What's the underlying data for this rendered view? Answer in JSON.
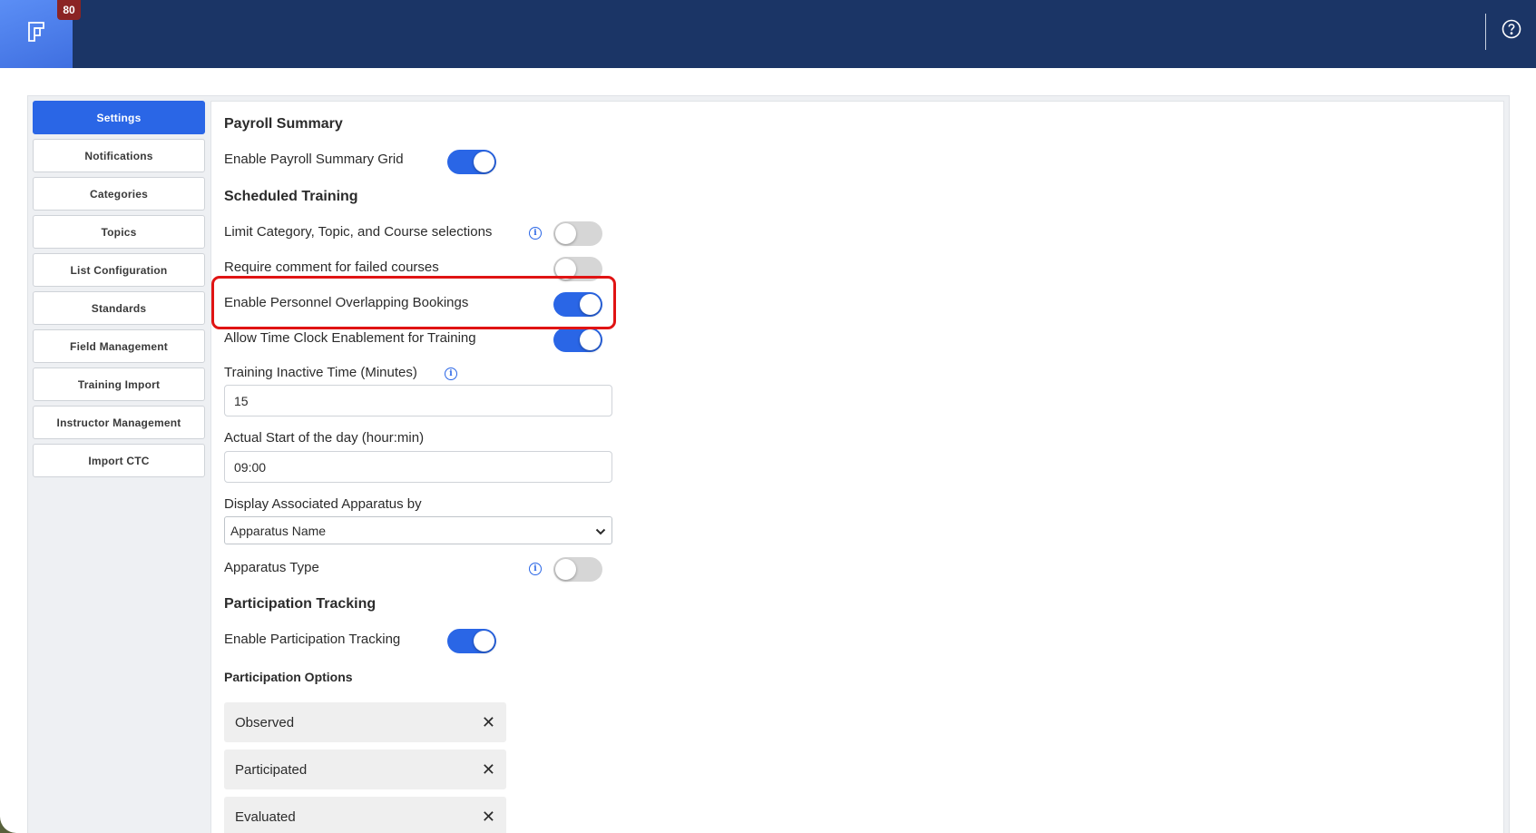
{
  "app": {
    "notification_count": "80"
  },
  "sidebar": {
    "items": [
      {
        "label": "Settings",
        "active": true
      },
      {
        "label": "Notifications"
      },
      {
        "label": "Categories"
      },
      {
        "label": "Topics"
      },
      {
        "label": "List Configuration"
      },
      {
        "label": "Standards"
      },
      {
        "label": "Field Management"
      },
      {
        "label": "Training Import"
      },
      {
        "label": "Instructor Management"
      },
      {
        "label": "Import CTC"
      }
    ]
  },
  "settings": {
    "payroll_title": "Payroll Summary",
    "enable_payroll_grid": {
      "label": "Enable Payroll Summary Grid",
      "on": true
    },
    "scheduled_title": "Scheduled Training",
    "limit_selections": {
      "label": "Limit Category, Topic, and Course selections",
      "on": false
    },
    "require_comment": {
      "label": "Require comment for failed courses",
      "on": false
    },
    "overlapping_bookings": {
      "label": "Enable Personnel Overlapping Bookings",
      "on": true
    },
    "time_clock": {
      "label": "Allow Time Clock Enablement for Training",
      "on": true
    },
    "inactive_time": {
      "label": "Training Inactive Time (Minutes)",
      "value": "15"
    },
    "start_of_day": {
      "label": "Actual Start of the day (hour:min)",
      "value": "09:00"
    },
    "apparatus_display": {
      "label": "Display Associated Apparatus by",
      "selected": "Apparatus Name"
    },
    "apparatus_type": {
      "label": "Apparatus Type",
      "on": false
    },
    "participation_title": "Participation Tracking",
    "enable_participation": {
      "label": "Enable Participation Tracking",
      "on": true
    },
    "participation_options_title": "Participation Options",
    "participation_options": [
      "Observed",
      "Participated",
      "Evaluated"
    ]
  },
  "colors": {
    "accent": "#2a66e6",
    "topbar": "#1b3566",
    "highlight": "#e01414"
  }
}
